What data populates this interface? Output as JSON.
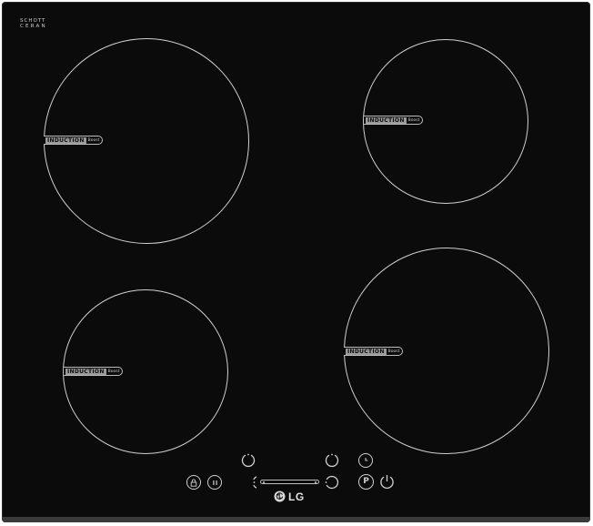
{
  "glass_brand": {
    "line1": "SCHOTT",
    "line2": "CERAN"
  },
  "zones": [
    {
      "name": "top-left",
      "badge_main": "INDUCTION",
      "badge_sub": "Boost"
    },
    {
      "name": "top-right",
      "badge_main": "INDUCTION",
      "badge_sub": "Boost"
    },
    {
      "name": "bottom-left",
      "badge_main": "INDUCTION",
      "badge_sub": "Boost"
    },
    {
      "name": "bottom-right",
      "badge_main": "INDUCTION",
      "badge_sub": "Boost"
    }
  ],
  "controls": {
    "lock_icon": "lock-icon",
    "pause_icon": "pause-icon",
    "timer_icon": "clock-icon",
    "power_boost_label": "P",
    "power_icon": "power-icon"
  },
  "logo": {
    "wordmark": "LG"
  },
  "colors": {
    "glass": "#0b0b0b",
    "print": "#d0d0d0"
  }
}
